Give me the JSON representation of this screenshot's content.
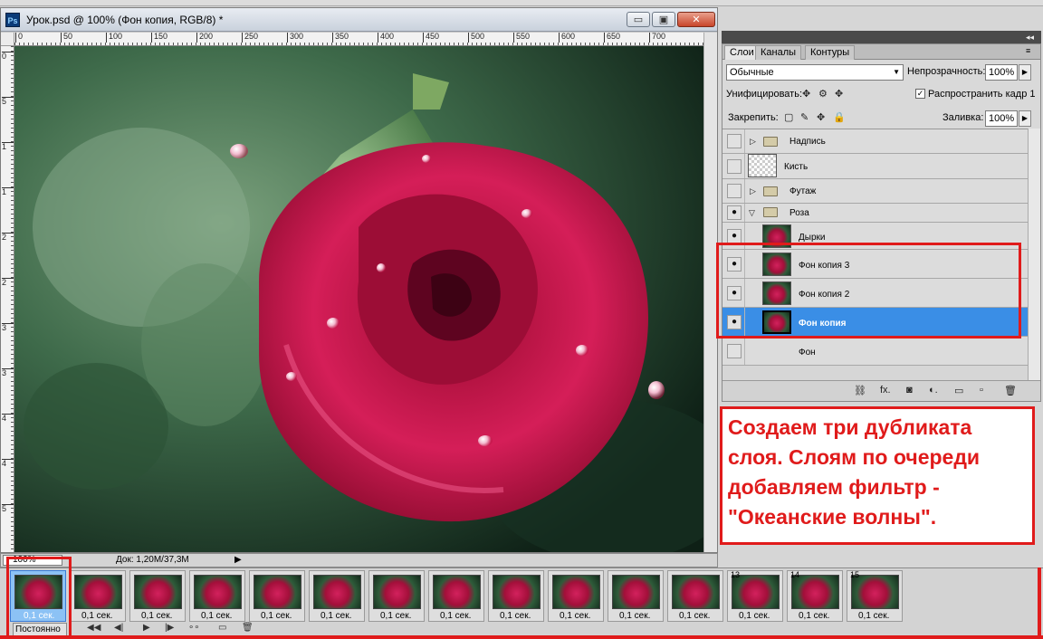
{
  "document": {
    "title": "Урок.psd @ 100% (Фон копия, RGB/8) *",
    "ps_logo": "Ps",
    "window_buttons": {
      "minimize": "▭",
      "maximize": "▣",
      "close": "✕"
    },
    "ruler_h_ticks": [
      "0",
      "50",
      "100",
      "150",
      "200",
      "250",
      "300",
      "350",
      "400",
      "450",
      "500",
      "550",
      "600",
      "650",
      "700"
    ],
    "ruler_v_ticks": [
      "0",
      "5",
      "1",
      "1",
      "2",
      "2",
      "3",
      "3",
      "4",
      "4",
      "5"
    ]
  },
  "status": {
    "zoom": "100%",
    "doc_info": "Док: 1,20M/37,3M",
    "arrow": "▶"
  },
  "layers_panel": {
    "collapse": "◂◂",
    "tabs": [
      "Слои",
      "Каналы",
      "Контуры"
    ],
    "menu_icon": "≡",
    "blend_mode": "Обычные",
    "opacity_label": "Непрозрачность:",
    "opacity": "100%",
    "unify_label": "Унифицировать:",
    "unify_icons": [
      "✥",
      "⚙",
      "✥"
    ],
    "propagate_checked": "✓",
    "propagate_label": "Распространить кадр 1",
    "lock_label": "Закрепить:",
    "lock_icons": [
      "▢",
      "✎",
      "✥",
      "🔒"
    ],
    "fill_label": "Заливка:",
    "fill": "100%",
    "layers": [
      {
        "name": "Надпись",
        "visible": false,
        "type": "group"
      },
      {
        "name": "Кисть",
        "visible": false,
        "type": "transparent"
      },
      {
        "name": "Футаж",
        "visible": false,
        "type": "group"
      },
      {
        "name": "Роза",
        "visible": true,
        "type": "group-open"
      },
      {
        "name": "Дырки",
        "visible": true,
        "type": "image"
      },
      {
        "name": "Фон копия 3",
        "visible": true,
        "type": "image"
      },
      {
        "name": "Фон копия 2",
        "visible": true,
        "type": "image"
      },
      {
        "name": "Фон копия",
        "visible": true,
        "type": "image",
        "selected": true
      },
      {
        "name": "Фон",
        "visible": false,
        "type": "image"
      }
    ],
    "eye_glyph": "●",
    "footer_icons": [
      "⛓",
      "fx.",
      "◙",
      "◐.",
      "▭",
      "▫",
      "🗑"
    ]
  },
  "callout": {
    "text": "Создаем три дубликата слоя. Слоям по очереди добавляем фильтр - \"Океанские волны\"."
  },
  "timeline": {
    "frames": [
      {
        "num": "",
        "delay": "0,1 сек.",
        "selected": true
      },
      {
        "num": "",
        "delay": "0,1 сек."
      },
      {
        "num": "",
        "delay": "0,1 сек."
      },
      {
        "num": "",
        "delay": "0,1 сек."
      },
      {
        "num": "",
        "delay": "0,1 сек."
      },
      {
        "num": "",
        "delay": "0,1 сек."
      },
      {
        "num": "",
        "delay": "0,1 сек."
      },
      {
        "num": "",
        "delay": "0,1 сек."
      },
      {
        "num": "",
        "delay": "0,1 сек."
      },
      {
        "num": "",
        "delay": "0,1 сек."
      },
      {
        "num": "",
        "delay": "0,1 сек."
      },
      {
        "num": "",
        "delay": "0,1 сек."
      },
      {
        "num": "13",
        "delay": "0,1 сек."
      },
      {
        "num": "14",
        "delay": "0,1 сек."
      },
      {
        "num": "15",
        "delay": "0,1 сек."
      }
    ],
    "loop": "Постоянно",
    "controls": [
      "◀◀",
      "◀|",
      "▶",
      "|▶",
      "∘∘",
      "▭",
      "🗑"
    ]
  },
  "colors": {
    "highlight": "#e01b1b",
    "selection": "#3a8ee6"
  }
}
